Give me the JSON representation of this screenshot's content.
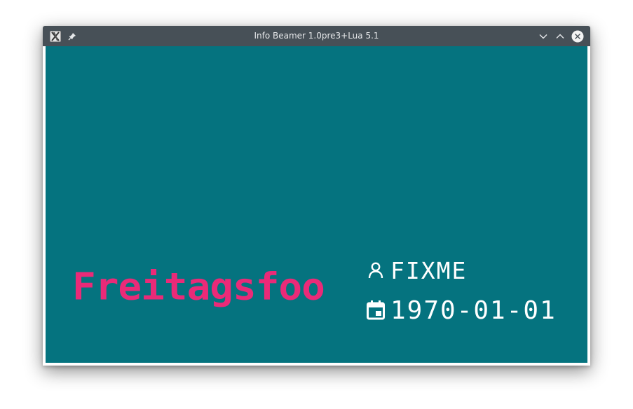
{
  "window": {
    "title": "Info Beamer 1.0pre3+Lua 5.1",
    "icons": {
      "app": "x-app-icon",
      "pin": "pin-icon",
      "minimize": "chevron-down-icon",
      "maximize": "chevron-up-icon",
      "close": "close-icon"
    }
  },
  "display": {
    "background": "#05737f",
    "brand_text": "Freitagsfoo",
    "brand_color": "#ea2a78",
    "host_icon": "user-icon",
    "host_name": "FIXME",
    "date_icon": "calendar-icon",
    "date": "1970-01-01"
  }
}
